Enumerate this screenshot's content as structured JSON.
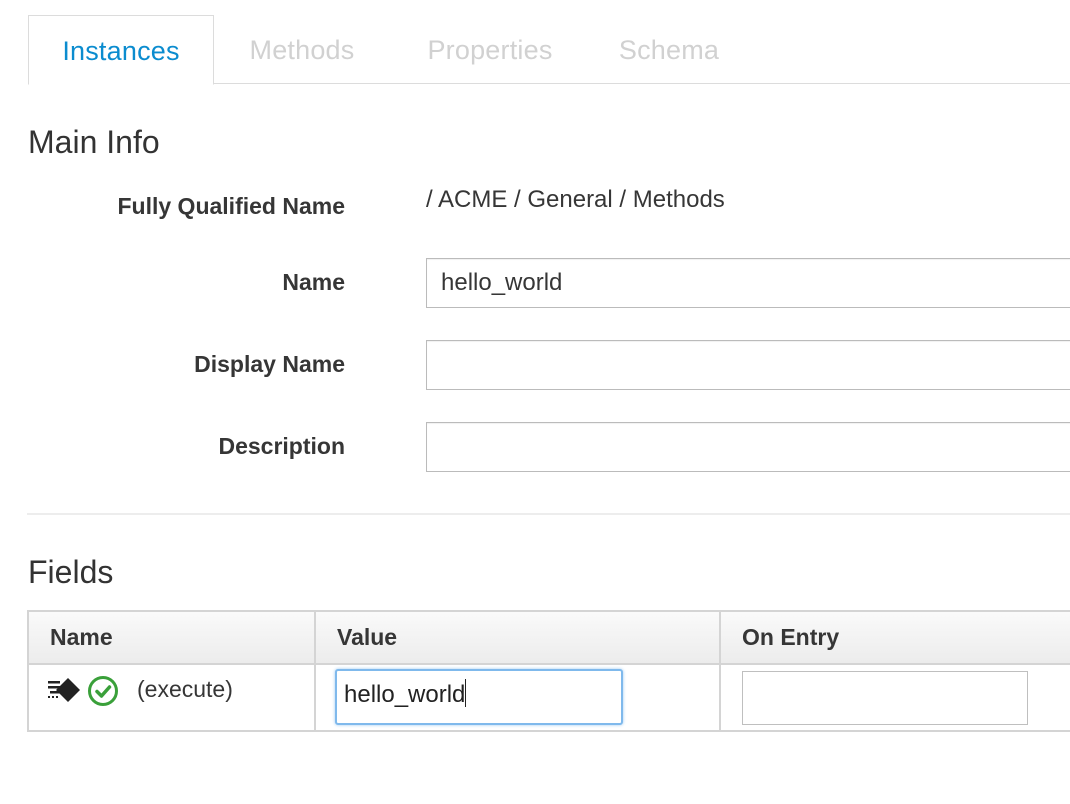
{
  "tabs": [
    {
      "label": "Instances",
      "active": true
    },
    {
      "label": "Methods",
      "active": false
    },
    {
      "label": "Properties",
      "active": false
    },
    {
      "label": "Schema",
      "active": false
    }
  ],
  "main_info": {
    "title": "Main Info",
    "fully_qualified_name": {
      "label": "Fully Qualified Name",
      "value": "/ ACME / General / Methods"
    },
    "name": {
      "label": "Name",
      "value": "hello_world"
    },
    "display_name": {
      "label": "Display Name",
      "value": ""
    },
    "description": {
      "label": "Description",
      "value": ""
    }
  },
  "fields": {
    "title": "Fields",
    "columns": [
      "Name",
      "Value",
      "On Entry"
    ],
    "rows": [
      {
        "icons": [
          "method-icon",
          "check-circle-icon"
        ],
        "name": "(execute)",
        "value": "hello_world",
        "on_entry": ""
      }
    ]
  },
  "colors": {
    "active_tab": "#0b8ccf",
    "inactive_tab": "#d1d1d1",
    "success_icon": "#3aa03a",
    "focus_border": "#7fb9ec"
  }
}
